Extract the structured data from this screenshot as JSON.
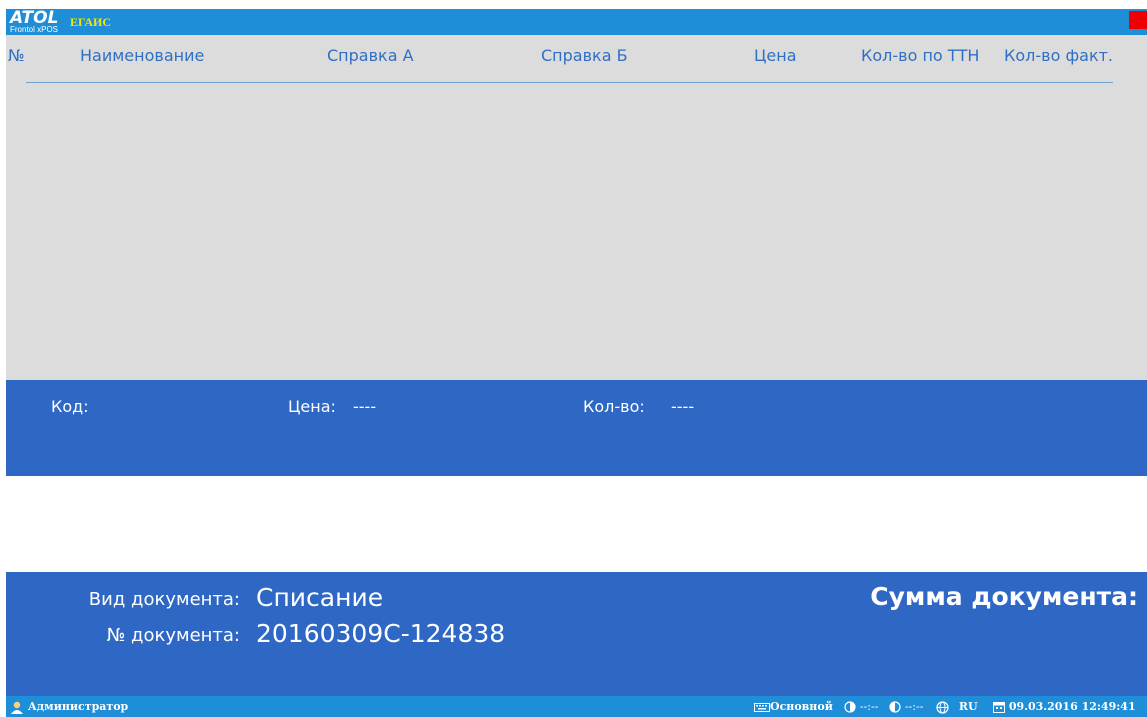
{
  "app": {
    "logo_main": "ATOL",
    "logo_sub": "Frontol xPOS",
    "module": "ЕГАИС",
    "close_color": "#ee0000"
  },
  "table": {
    "columns": [
      "№",
      "Наименование",
      "Справка А",
      "Справка Б",
      "Цена",
      "Кол-во по ТТН",
      "Кол-во факт."
    ],
    "rows": []
  },
  "info": {
    "code_label": "Код:",
    "price_label": "Цена:",
    "price_value": "----",
    "qty_label": "Кол-во:",
    "qty_value": "----"
  },
  "document": {
    "type_label": "Вид документа:",
    "type_value": "Списание",
    "number_label": "№ документа:",
    "number_value": "20160309С-124838",
    "sum_label": "Сумма документа:"
  },
  "status": {
    "user": "Администратор",
    "layout": "Основной",
    "time1": "--:--",
    "time2": "--:--",
    "lang": "RU",
    "datetime": "09.03.2016 12:49:41"
  },
  "colors": {
    "titlebar": "#1f8ed8",
    "panel": "#2f68c4",
    "table_bg": "#dcdcdc",
    "header_text": "#2f6fc4",
    "module_text": "#f5e600"
  }
}
